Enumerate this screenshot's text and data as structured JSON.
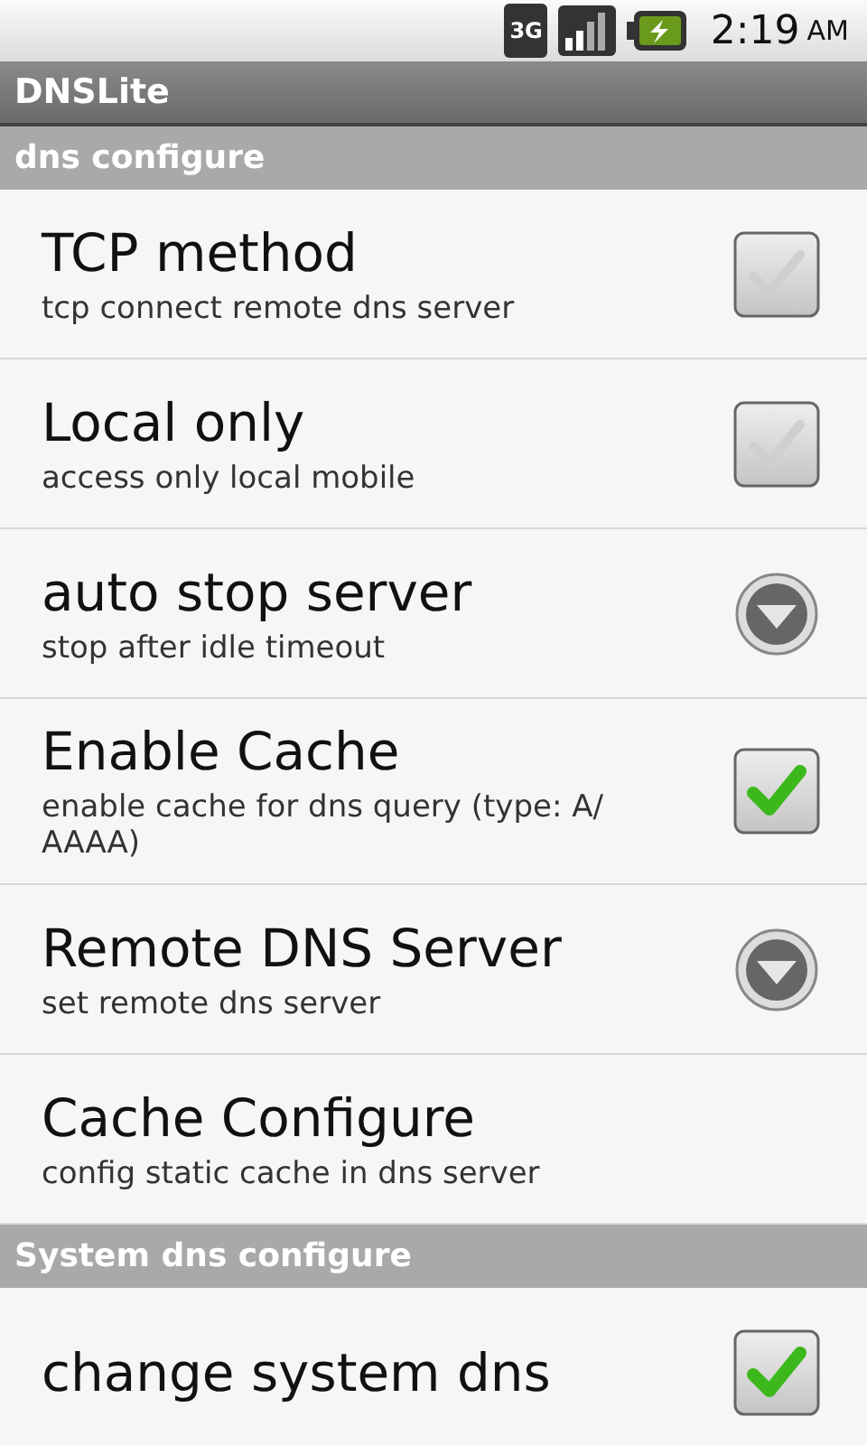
{
  "status_bar": {
    "time": "2:19",
    "ampm": "AM",
    "network": "3G"
  },
  "title_bar": {
    "title": "DNSLite"
  },
  "sections": [
    {
      "header": "dns configure",
      "items": [
        {
          "kind": "checkbox",
          "title": "TCP method",
          "summary": "tcp connect remote dns server",
          "checked": false
        },
        {
          "kind": "checkbox",
          "title": "Local only",
          "summary": "access only local mobile",
          "checked": false
        },
        {
          "kind": "dropdown",
          "title": "auto stop server",
          "summary": "stop after idle timeout"
        },
        {
          "kind": "checkbox",
          "title": "Enable Cache",
          "summary": "enable cache for dns query (type: A/ AAAA)",
          "checked": true
        },
        {
          "kind": "dropdown",
          "title": "Remote DNS Server",
          "summary": "set remote dns server"
        },
        {
          "kind": "plain",
          "title": "Cache Configure",
          "summary": "config static cache in dns server"
        }
      ]
    },
    {
      "header": "System dns configure",
      "items": [
        {
          "kind": "checkbox",
          "title": "change system dns",
          "checked": true
        }
      ]
    }
  ]
}
